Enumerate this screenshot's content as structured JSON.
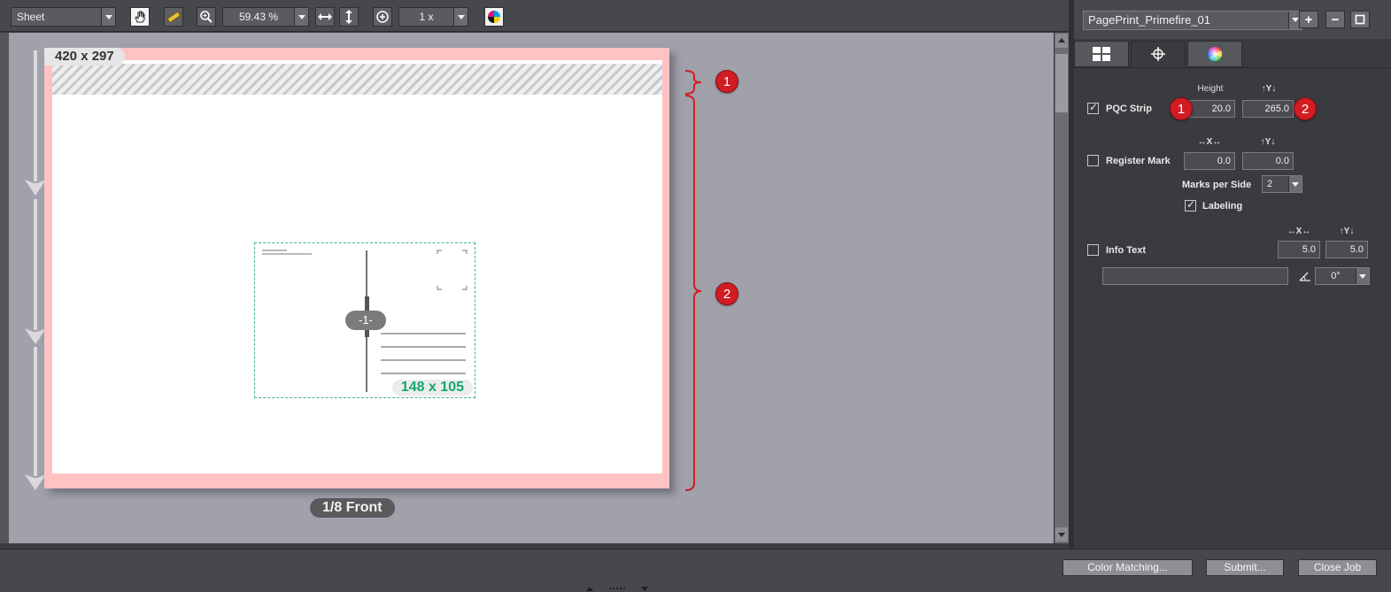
{
  "toolbar": {
    "view_select": "Sheet",
    "zoom_value": "59.43 %",
    "multiplier": "1 x"
  },
  "sheet": {
    "size_label": "420 x 297",
    "caption": "1/8 Front",
    "page_size": "148 x 105",
    "page_number": "-1-"
  },
  "annotations": {
    "badge_1": "1",
    "badge_2": "2"
  },
  "panel": {
    "device_select": "PagePrint_Primefire_01",
    "add_label": "+",
    "remove_label": "−",
    "pqc": {
      "label": "PQC Strip",
      "checked": true,
      "height_header": "Height",
      "y_header": "↑Y↓",
      "height_value": "20.0",
      "y_value": "265.0"
    },
    "register": {
      "label": "Register Mark",
      "checked": false,
      "x_header": "↔X↔",
      "y_header": "↑Y↓",
      "x_value": "0.0",
      "y_value": "0.0",
      "marks_label": "Marks per Side",
      "marks_value": "2",
      "labeling_label": "Labeling",
      "labeling_checked": true
    },
    "info": {
      "label": "Info Text",
      "checked": false,
      "x_header": "↔X↔",
      "y_header": "↑Y↓",
      "x_value": "5.0",
      "y_value": "5.0",
      "text_value": "",
      "angle_value": "0°"
    }
  },
  "bottom": {
    "color_matching": "Color Matching...",
    "submit": "Submit...",
    "close_job": "Close Job"
  },
  "colors": {
    "badge_red": "#d11c24",
    "sheet_margin": "#ffc2c2",
    "page_green": "#13a86c",
    "canvas": "#a1a1ab"
  }
}
